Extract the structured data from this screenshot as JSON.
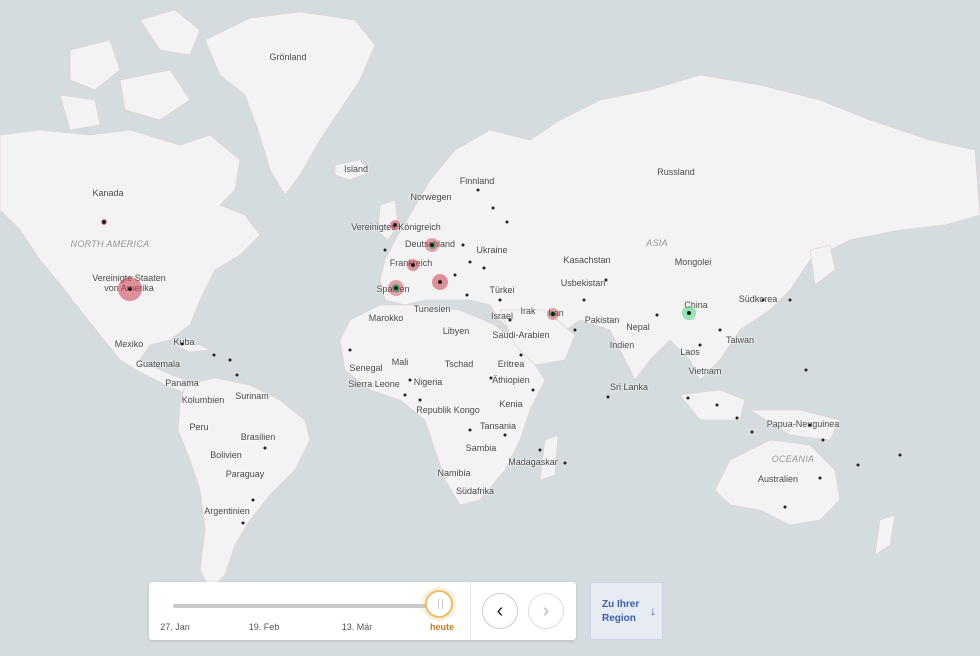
{
  "map": {
    "labels": [
      {
        "text": "Grönland",
        "kind": "country"
      },
      {
        "text": "Kanada",
        "kind": "country"
      },
      {
        "text": "NORTH AMERICA",
        "kind": "continent"
      },
      {
        "text": "Vereinigte Staaten von Amerika",
        "kind": "country"
      },
      {
        "text": "Mexiko",
        "kind": "country"
      },
      {
        "text": "Kuba",
        "kind": "country"
      },
      {
        "text": "Guatemala",
        "kind": "country"
      },
      {
        "text": "Panama",
        "kind": "country"
      },
      {
        "text": "Kolumbien",
        "kind": "country"
      },
      {
        "text": "Surinam",
        "kind": "country"
      },
      {
        "text": "Peru",
        "kind": "country"
      },
      {
        "text": "Brasilien",
        "kind": "country"
      },
      {
        "text": "Bolivien",
        "kind": "country"
      },
      {
        "text": "Paraguay",
        "kind": "country"
      },
      {
        "text": "Argentinien",
        "kind": "country"
      },
      {
        "text": "Island",
        "kind": "country"
      },
      {
        "text": "Finnland",
        "kind": "country"
      },
      {
        "text": "Norwegen",
        "kind": "country"
      },
      {
        "text": "Vereinigtes Königreich",
        "kind": "country"
      },
      {
        "text": "Deutschland",
        "kind": "country"
      },
      {
        "text": "Frankreich",
        "kind": "country"
      },
      {
        "text": "Ukraine",
        "kind": "country"
      },
      {
        "text": "Spanien",
        "kind": "country"
      },
      {
        "text": "Türkei",
        "kind": "country"
      },
      {
        "text": "Tunesien",
        "kind": "country"
      },
      {
        "text": "Marokko",
        "kind": "country"
      },
      {
        "text": "Libyen",
        "kind": "country"
      },
      {
        "text": "Israel",
        "kind": "country"
      },
      {
        "text": "Irak",
        "kind": "country"
      },
      {
        "text": "Iran",
        "kind": "country"
      },
      {
        "text": "Saudi-Arabien",
        "kind": "country"
      },
      {
        "text": "Senegal",
        "kind": "country"
      },
      {
        "text": "Mali",
        "kind": "country"
      },
      {
        "text": "Tschad",
        "kind": "country"
      },
      {
        "text": "Eritrea",
        "kind": "country"
      },
      {
        "text": "Sierra Leone",
        "kind": "country"
      },
      {
        "text": "Nigeria",
        "kind": "country"
      },
      {
        "text": "Äthiopien",
        "kind": "country"
      },
      {
        "text": "Republik Kongo",
        "kind": "country"
      },
      {
        "text": "Kenia",
        "kind": "country"
      },
      {
        "text": "Tansania",
        "kind": "country"
      },
      {
        "text": "Sambia",
        "kind": "country"
      },
      {
        "text": "Madagaskar",
        "kind": "country"
      },
      {
        "text": "Namibia",
        "kind": "country"
      },
      {
        "text": "Südafrika",
        "kind": "country"
      },
      {
        "text": "Russland",
        "kind": "country"
      },
      {
        "text": "Kasachstan",
        "kind": "country"
      },
      {
        "text": "ASIA",
        "kind": "continent"
      },
      {
        "text": "Mongolei",
        "kind": "country"
      },
      {
        "text": "Usbekistan",
        "kind": "country"
      },
      {
        "text": "Pakistan",
        "kind": "country"
      },
      {
        "text": "Nepal",
        "kind": "country"
      },
      {
        "text": "China",
        "kind": "country"
      },
      {
        "text": "Südkorea",
        "kind": "country"
      },
      {
        "text": "Taiwan",
        "kind": "country"
      },
      {
        "text": "Indien",
        "kind": "country"
      },
      {
        "text": "Laos",
        "kind": "country"
      },
      {
        "text": "Vietnam",
        "kind": "country"
      },
      {
        "text": "Sri Lanka",
        "kind": "country"
      },
      {
        "text": "Papua-Neuguinea",
        "kind": "country"
      },
      {
        "text": "OCEANIA",
        "kind": "continent"
      },
      {
        "text": "Australien",
        "kind": "country"
      }
    ],
    "colors": {
      "ocean": "#d5dcdf",
      "land": "#f3f3f3",
      "case_bubble": "#cd3c50",
      "china_bubble": "#50d282"
    }
  },
  "timeline": {
    "ticks": [
      "27. Jan",
      "19. Feb",
      "13. Mär",
      "heute"
    ],
    "progress": 1.0,
    "prev_icon": "chevron-left-icon",
    "next_icon": "chevron-right-icon"
  },
  "region_button": {
    "label": "Zu Ihrer Region",
    "icon": "arrow-down-icon"
  }
}
